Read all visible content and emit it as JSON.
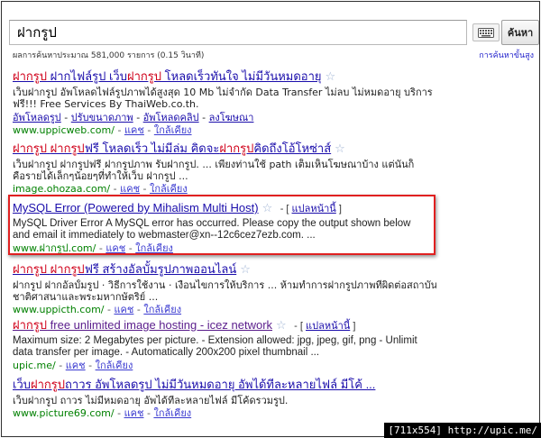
{
  "search": {
    "query": "ฝากรูป",
    "button_label": "ค้นหา",
    "keyboard_icon": "keyboard-icon"
  },
  "stats": {
    "text": "ผลการค้นหาประมาณ 581,000 รายการ (0.15 วินาที)",
    "advanced_link": "การค้นหาขั้นสูง"
  },
  "results": [
    {
      "title_parts": [
        {
          "text": "ฝากรูป",
          "hl": true
        },
        {
          "text": " ฝากไฟล์รูป เว็บ",
          "hl": false
        },
        {
          "text": "ฝากรูป",
          "hl": true
        },
        {
          "text": " โหลดเร็วทันใจ ไม่มีวันหมดอายุ",
          "hl": false
        }
      ],
      "snippet_lines": [
        "เว็บฝากรูป อัพโหลดไฟล์รูปภาพได้สูงสุด 10 Mb ไม่จำกัด Data Transfer ไม่ลบ ไม่หมดอายุ บริการ",
        "ฟรี!!! Free Services By ThaiWeb.co.th."
      ],
      "sublinks": [
        "อัพโหลดรูป",
        "ปรับขนาดภาพ",
        "อัพโหลดคลิป",
        "ลงโฆษณา"
      ],
      "url": "www.uppicweb.com/",
      "cache_label": "แคช",
      "similar_label": "ใกล้เคียง"
    },
    {
      "title_parts": [
        {
          "text": "ฝากรูป",
          "hl": true
        },
        {
          "text": " ",
          "hl": false
        },
        {
          "text": "ฝากรูป",
          "hl": true
        },
        {
          "text": "ฟรี โหลดเร็ว ไม่มีล่ม คิดจะ",
          "hl": false
        },
        {
          "text": "ฝากรูป",
          "hl": true
        },
        {
          "text": "คิดถึงโอ้โหซ่าส์",
          "hl": false
        }
      ],
      "snippet_lines": [
        "เว็บฝากรูป ฝากรูปฟรี ฝากรูปภาพ รับฝากรูป. ... เพียงท่านใช้ path เต็มเห็นโฆษณาบ้าง แต่นั่นก็",
        "คือรายได้เล็กๆน้อยๆที่ทำให้เว็บ ฝากรูป ..."
      ],
      "url": "image.ohozaa.com/",
      "cache_label": "แคช",
      "similar_label": "ใกล้เคียง"
    },
    {
      "title": "MySQL Error (Powered by Mihalism Multi Host)",
      "translate_label": "แปลหน้านี้",
      "snippet": "MySQL Driver Error A MySQL error has occurred. Please copy the output shown below and email it immediately to webmaster@xn--12c6cez7ezb.com. ...",
      "url": "www.ฝากรูป.com/",
      "cache_label": "แคช",
      "similar_label": "ใกล้เคียง"
    },
    {
      "title_parts": [
        {
          "text": "ฝากรูป",
          "hl": true
        },
        {
          "text": " ",
          "hl": false
        },
        {
          "text": "ฝากรูป",
          "hl": true
        },
        {
          "text": "ฟรี สร้างอัลบั้มรูปภาพออนไลน์",
          "hl": false
        }
      ],
      "snippet_lines": [
        "ฝากรูป ฝากอัลบั้มรูป · วิธีการใช้งาน · เงื่อนไขการให้บริการ ... ห้ามทำการฝากรูปภาพที่ผิดต่อสถาบัน",
        "ชาติศาสนาและพระมหากษัตริย์ ..."
      ],
      "url": "www.uppicth.com/",
      "cache_label": "แคช",
      "similar_label": "ใกล้เคียง"
    },
    {
      "title_parts": [
        {
          "text": "ฝากรูป",
          "hl": true
        },
        {
          "text": " free unlimited image hosting - icez network",
          "hl": false
        }
      ],
      "translate_label": "แปลหน้านี้",
      "snippet": "Maximum size: 2 Megabytes per picture. - Extension allowed: jpg, jpeg, gif, png - Unlimit data transfer per image. - Automatically 200x200 pixel thumbnail ...",
      "url": "upic.me/",
      "cache_label": "แคช",
      "similar_label": "ใกล้เคียง"
    },
    {
      "title_parts": [
        {
          "text": "เว็บ",
          "hl": false
        },
        {
          "text": "ฝากรูป",
          "hl": true
        },
        {
          "text": "ถาวร อัพโหลดรูป ไม่มีวันหมดอายุ อัพได้ทีละหลายไฟล์ มีโค้ ...",
          "hl": false
        }
      ],
      "snippet_lines": [
        "เว็บฝากรูป ถาวร ไม่มีหมดอายุ อัพได้ทีละหลายไฟล์ มีโค้ดรวมรูป."
      ],
      "url": "www.picture69.com/",
      "cache_label": "แคช",
      "similar_label": "ใกล้เคียง"
    }
  ],
  "footer_tag": "[711x554] http://upic.me/",
  "colors": {
    "link": "#1a0dab",
    "highlight_term": "#d0001a",
    "url_green": "#008000",
    "highlight_box": "#e02020"
  }
}
